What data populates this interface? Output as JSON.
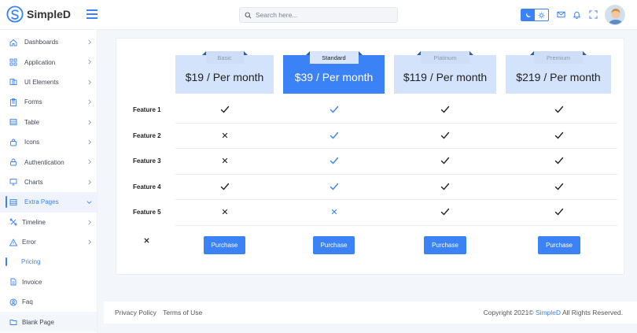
{
  "app": {
    "name": "SimpleD"
  },
  "header": {
    "search_placeholder": "Search here..."
  },
  "sidebar": {
    "items": [
      {
        "label": "Dashboards",
        "icon": "home-icon"
      },
      {
        "label": "Application",
        "icon": "grid-icon"
      },
      {
        "label": "UI Elements",
        "icon": "layers-icon"
      },
      {
        "label": "Forms",
        "icon": "clipboard-icon"
      },
      {
        "label": "Table",
        "icon": "table-icon"
      },
      {
        "label": "Icons",
        "icon": "bag-icon"
      },
      {
        "label": "Authentication",
        "icon": "lock-icon"
      },
      {
        "label": "Charts",
        "icon": "monitor-icon"
      },
      {
        "label": "Extra Pages",
        "icon": "pages-icon"
      }
    ],
    "sub_items": [
      {
        "label": "Timeline",
        "icon": "timeline-icon"
      },
      {
        "label": "Error",
        "icon": "warning-icon"
      },
      {
        "label": "Pricing",
        "icon": ""
      },
      {
        "label": "Invoice",
        "icon": "document-icon"
      },
      {
        "label": "Faq",
        "icon": "help-icon"
      },
      {
        "label": "Blank Page",
        "icon": "folder-icon"
      }
    ]
  },
  "pricing": {
    "plans": [
      {
        "name": "Basic",
        "amount": "$19",
        "period": "/ Per month",
        "featured": false
      },
      {
        "name": "Standard",
        "amount": "$39",
        "period": "/ Per month",
        "featured": true
      },
      {
        "name": "Platinum",
        "amount": "$119",
        "period": "/ Per month",
        "featured": false
      },
      {
        "name": "Premium",
        "amount": "$219",
        "period": "/ Per month",
        "featured": false
      }
    ],
    "features": [
      "Feature 1",
      "Feature 2",
      "Feature 3",
      "Feature 4",
      "Feature 5"
    ],
    "availability": [
      [
        true,
        true,
        true,
        true
      ],
      [
        false,
        true,
        true,
        true
      ],
      [
        false,
        true,
        true,
        true
      ],
      [
        true,
        true,
        true,
        true
      ],
      [
        false,
        false,
        true,
        true
      ]
    ],
    "purchase_label": "Purchase"
  },
  "footer": {
    "privacy": "Privacy Policy",
    "terms": "Terms of Use",
    "copyright": "Copyright 2021©",
    "brand": "SimpleD",
    "rights": "All Rights Reserved."
  },
  "colors": {
    "accent": "#3b82f6",
    "plan_bg": "#d3e3fc"
  }
}
